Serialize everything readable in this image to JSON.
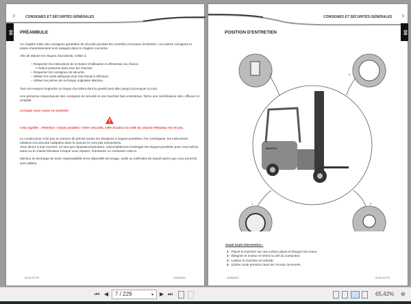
{
  "left_page": {
    "header": "CONSIGNES ET SÉCURITÉS GÉNÉRALES",
    "page_number": "2",
    "tab": "00",
    "title": "PRÉAMBULE",
    "paragraphs": [
      "Ce chapitre traite des consignes générales de sécurité pendant les contrôles et travaux d'entretien. Les autres consignes et textes d'avertissement sont indiqués dans le chapitre concerné.",
      "Afin de réduire les risques d'accidents, veillez à:"
    ],
    "list": [
      "– Respecter les instructions de la Notice d'Utilisation et d'Entretien du chariot.",
      "⇒ Notice présente dans tous les chariots.",
      "– Respecter les consignes de sécurité.",
      "– Utiliser les outils adéquats pour tout travail à effectuer.",
      "– Utiliser les pièces de rechange originales Manitou."
    ],
    "p3": "Tout non-respect engendre un risque d'accident dont la gravité peut aller jusqu'à provoquer la mort.",
    "p4": "Une personne respectueuse des consignes de sécurité et une machine bien entretenue, forme une combinaison sûre, efficace et rentable.",
    "warn1": "Lorsque vous voyez ce symbole :",
    "warn2": "Cela signifie : Attention ! Soyez prudent ! Votre sécurité, celle d'autrui ou celle du chariot élévateur est en jeu.",
    "p5": "Le constructeur n'est pas en mesure de prévoir toutes les situations à risques possibles. Par conséquent, les instructions relatives à la sécurité indiquées dans le manuel ne sont pas exhaustives.",
    "p6": "Vous devez à tout moment, en tant que réparateur/opérateur, raisonnablement envisager les risques possibles pour vous-même, autrui ou le chariot élévateur lorsque vous réparez, entretenez ou conduisez celui-ci.",
    "p7": "Manitou se décharge de toute responsabilité si les dispositifs de levage, outils ou méthodes de travail autres que ceux prescrits sont utilisés.",
    "footer_left": "00-00-V2 ITR",
    "footer_right": "01/05/2013"
  },
  "right_page": {
    "header": "CONSIGNES ET SÉCURITÉS GÉNÉRALES",
    "page_number": "3",
    "tab": "00",
    "title": "POSITION D'ENTRETIEN",
    "callouts": [
      "1",
      "2",
      "3",
      "4"
    ],
    "machine_brand": "MANITOU",
    "subtitle": "Avant toute intervention :",
    "steps": [
      {
        "n": "1",
        "t": "Placer la machine sur une surface plane et bloquez les roues."
      },
      {
        "n": "2",
        "t": "Éteignez le moteur et retirez la clef du contacteur."
      },
      {
        "n": "3",
        "t": "Laisser la machine se refroidir."
      },
      {
        "n": "4",
        "t": "Libérer toute pression dans les circuits concernés."
      }
    ],
    "footer_left": "01/05/2013",
    "footer_right": "00-00-V2 ITR"
  },
  "toolbar": {
    "page_value": "7 / 229",
    "zoom": "65,42%"
  }
}
